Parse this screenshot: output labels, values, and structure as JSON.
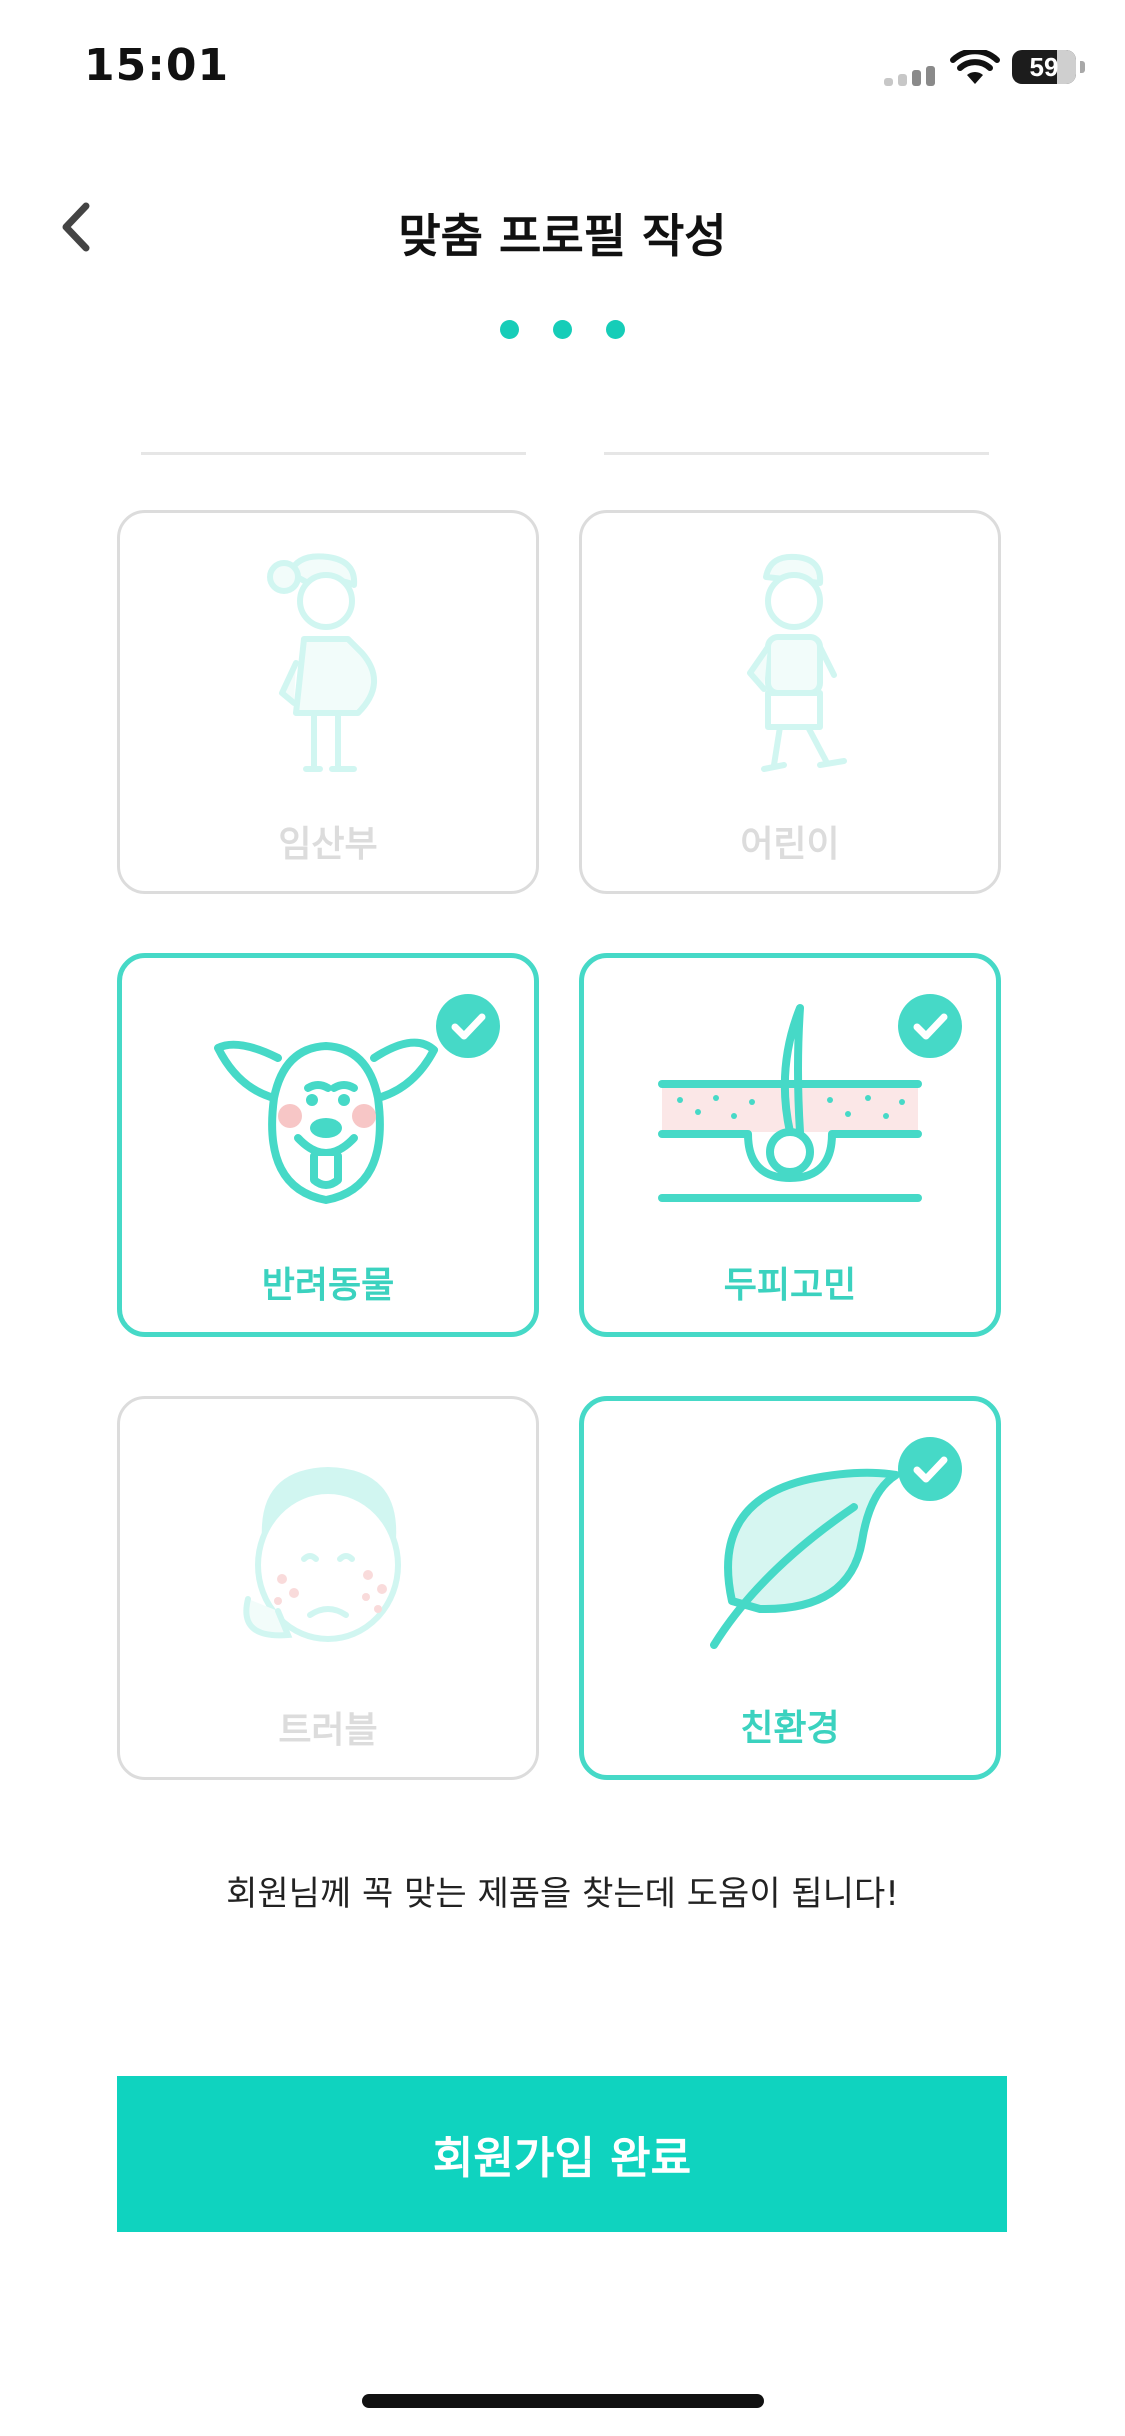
{
  "status_bar": {
    "time": "15:01",
    "battery": "59"
  },
  "header": {
    "title": "맞춤 프로필 작성"
  },
  "steps": {
    "count": 3
  },
  "cards": [
    {
      "label": "임산부",
      "selected": false,
      "icon": "pregnant-woman-icon"
    },
    {
      "label": "어린이",
      "selected": false,
      "icon": "child-icon"
    },
    {
      "label": "반려동물",
      "selected": true,
      "icon": "dog-icon"
    },
    {
      "label": "두피고민",
      "selected": true,
      "icon": "hair-follicle-icon"
    },
    {
      "label": "트러블",
      "selected": false,
      "icon": "troubled-skin-face-icon"
    },
    {
      "label": "친환경",
      "selected": true,
      "icon": "leaf-icon"
    }
  ],
  "helper_text": "회원님께 꼭 맞는 제품을 찾는데 도움이 됩니다!",
  "complete_button": "회원가입 완료",
  "colors": {
    "accent": "#0fd3bf",
    "accent_light": "#46d9c7",
    "disabled": "#dcdcdc",
    "blush": "#f7c6c6"
  }
}
